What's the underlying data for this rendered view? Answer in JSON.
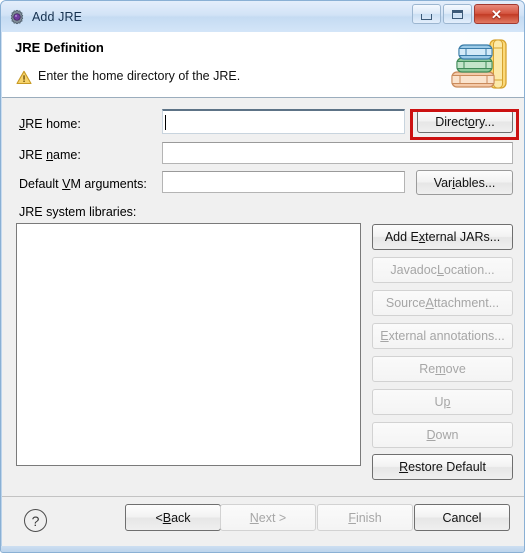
{
  "window": {
    "title": "Add JRE",
    "icon": "jre-gear-icon",
    "buttons": {
      "minimize": "minimize-icon",
      "maximize": "maximize-icon",
      "close": "✕"
    }
  },
  "header": {
    "title": "JRE Definition",
    "message": "Enter the home directory of the JRE.",
    "status_icon": "warning-triangle-icon",
    "banner_icon": "books-stack-icon"
  },
  "form": {
    "jre_home": {
      "label_pre": "J",
      "label_post": "RE home:",
      "value": "",
      "placeholder": "",
      "focused": true,
      "button": {
        "pre": "Direct",
        "mn": "o",
        "post": "ry...",
        "enabled": true,
        "highlighted": true
      }
    },
    "jre_name": {
      "label_pre": "JRE ",
      "label_mn": "n",
      "label_post": "ame:",
      "value": "",
      "placeholder": ""
    },
    "vm_args": {
      "label_pre": "Default ",
      "label_mn": "V",
      "label_post": "M arguments:",
      "value": "",
      "placeholder": "",
      "button": {
        "pre": "Var",
        "mn": "i",
        "post": "ables...",
        "enabled": true
      }
    },
    "libs_label": "JRE system libraries:"
  },
  "side_buttons": [
    {
      "pre": "Add E",
      "mn": "x",
      "post": "ternal JARs...",
      "enabled": true
    },
    {
      "pre": "Javadoc ",
      "mn": "L",
      "post": "ocation...",
      "enabled": false
    },
    {
      "pre": "Source ",
      "mn": "A",
      "post": "ttachment...",
      "enabled": false
    },
    {
      "pre": "",
      "mn": "E",
      "post": "xternal annotations...",
      "enabled": false
    },
    {
      "pre": "Re",
      "mn": "m",
      "post": "ove",
      "enabled": false
    },
    {
      "pre": "U",
      "mn": "p",
      "post": "",
      "enabled": false
    },
    {
      "pre": "",
      "mn": "D",
      "post": "own",
      "enabled": false
    },
    {
      "pre": "",
      "mn": "R",
      "post": "estore Default",
      "enabled": true
    }
  ],
  "footer": {
    "help_label": "?",
    "buttons": [
      {
        "pre": "< ",
        "mn": "B",
        "post": "ack",
        "enabled": true
      },
      {
        "pre": "",
        "mn": "N",
        "post": "ext >",
        "enabled": false
      },
      {
        "pre": "",
        "mn": "F",
        "post": "inish",
        "enabled": false
      },
      {
        "pre": "Cancel",
        "mn": "",
        "post": "",
        "enabled": true
      }
    ]
  },
  "colors": {
    "accent_red": "#cc1111",
    "window_border": "#8ab0d4",
    "titlebar": "#d2e3f6",
    "content_bg": "#f0f0f0",
    "close_button": "#c23b24"
  }
}
